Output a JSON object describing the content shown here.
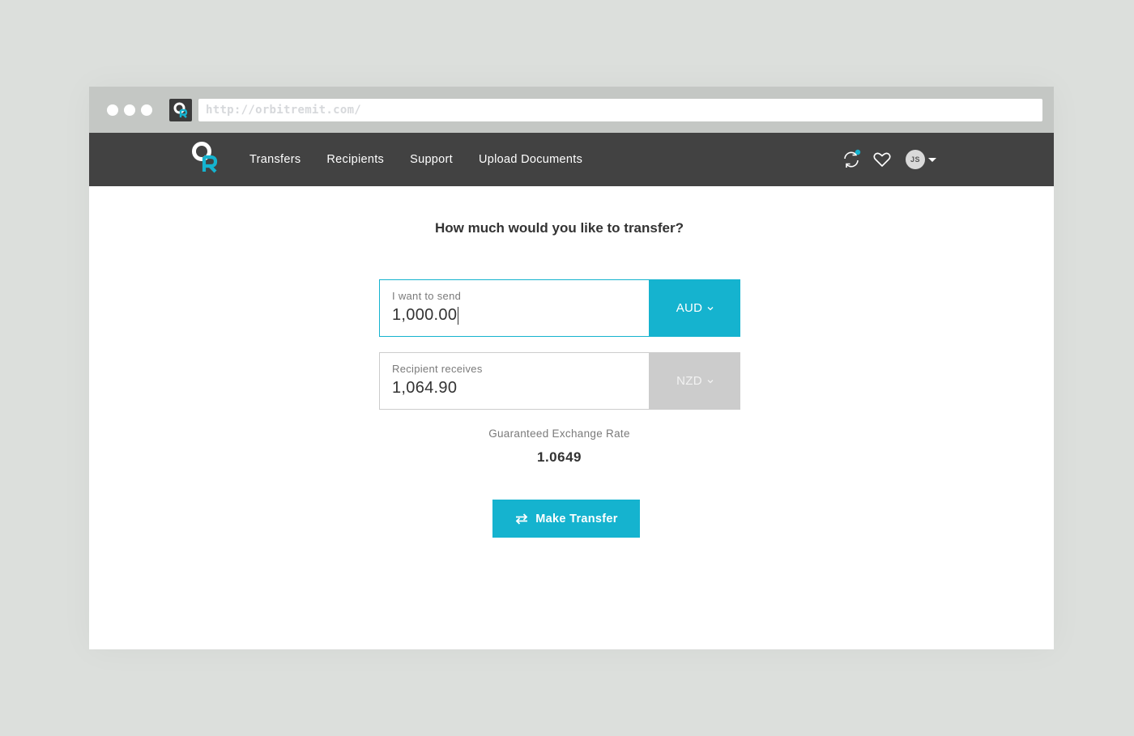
{
  "browser": {
    "url": "http://orbitremit.com/"
  },
  "nav": {
    "links": [
      "Transfers",
      "Recipients",
      "Support",
      "Upload Documents"
    ],
    "user_initials": "JS"
  },
  "transfer": {
    "heading": "How much would you like to transfer?",
    "send": {
      "label": "I want to send",
      "value": "1,000.00",
      "currency": "AUD"
    },
    "receive": {
      "label": "Recipient receives",
      "value": "1,064.90",
      "currency": "NZD"
    },
    "rate_label": "Guaranteed Exchange Rate",
    "rate_value": "1.0649",
    "button_label": "Make Transfer"
  },
  "colors": {
    "accent": "#15b3cf",
    "navbar": "#424242",
    "chrome": "#c4c7c4",
    "background": "#dcdfdc"
  }
}
